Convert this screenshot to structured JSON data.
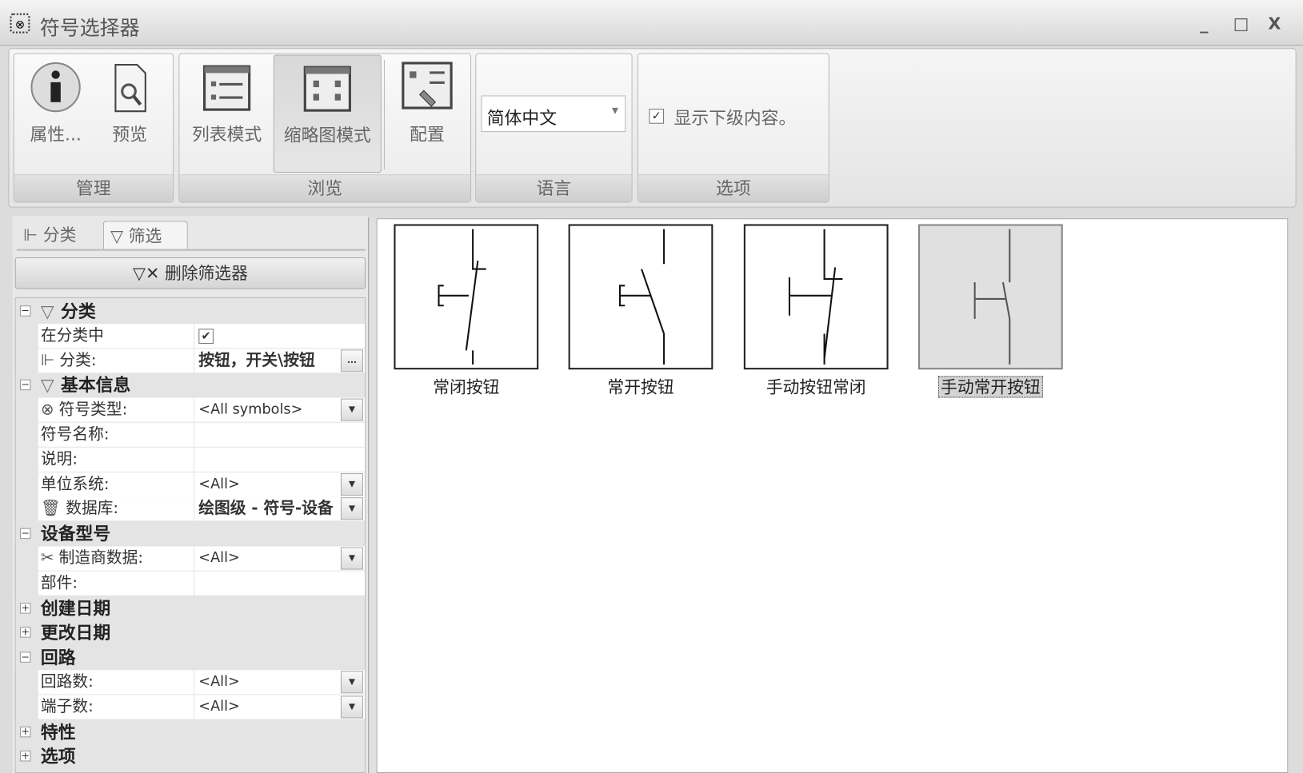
{
  "window": {
    "title": "符号选择器",
    "minimize": "_",
    "maximize": "□",
    "close": "X"
  },
  "ribbon": {
    "groups": {
      "manage": {
        "label": "管理",
        "properties": "属性...",
        "preview": "预览"
      },
      "browse": {
        "label": "浏览",
        "list_mode": "列表模式",
        "thumbnail_mode": "缩略图模式",
        "config": "配置"
      },
      "language": {
        "label": "语言",
        "value": "简体中文"
      },
      "options": {
        "label": "选项",
        "show_sub": "显示下级内容。",
        "show_sub_checked": true
      }
    }
  },
  "left": {
    "tabs": [
      {
        "label": "分类"
      },
      {
        "label": "筛选"
      }
    ],
    "delete_filter": "删除筛选器",
    "rows": [
      {
        "type": "group",
        "label": "分类",
        "expanded": true,
        "icon": "filter"
      },
      {
        "type": "check",
        "label": "在分类中",
        "checked": true
      },
      {
        "type": "more",
        "label": "分类:",
        "value": "按钮，开关\\按钮",
        "icon": "tree",
        "bold": true
      },
      {
        "type": "group",
        "label": "基本信息",
        "expanded": true,
        "icon": "filter"
      },
      {
        "type": "dropdown",
        "label": "符号类型:",
        "value": "<All symbols>",
        "icon": "symbol"
      },
      {
        "type": "text",
        "label": "符号名称:",
        "value": ""
      },
      {
        "type": "text",
        "label": "说明:",
        "value": ""
      },
      {
        "type": "dropdown",
        "label": "单位系统:",
        "value": "<All>"
      },
      {
        "type": "dropdown",
        "label": "数据库:",
        "value": "绘图级 - 符号-设备",
        "icon": "database",
        "bold": true
      },
      {
        "type": "group",
        "label": "设备型号",
        "expanded": true
      },
      {
        "type": "dropdown",
        "label": "制造商数据:",
        "value": "<All>",
        "icon": "tools"
      },
      {
        "type": "text",
        "label": "部件:",
        "value": ""
      },
      {
        "type": "group",
        "label": "创建日期",
        "expanded": false
      },
      {
        "type": "group",
        "label": "更改日期",
        "expanded": false
      },
      {
        "type": "group",
        "label": "回路",
        "expanded": true
      },
      {
        "type": "dropdown",
        "label": "回路数:",
        "value": "<All>"
      },
      {
        "type": "dropdown",
        "label": "端子数:",
        "value": "<All>"
      },
      {
        "type": "group",
        "label": "特性",
        "expanded": false
      },
      {
        "type": "group",
        "label": "选项",
        "expanded": false
      }
    ]
  },
  "symbols": [
    {
      "label": "常闭按钮"
    },
    {
      "label": "常开按钮"
    },
    {
      "label": "手动按钮常闭"
    },
    {
      "label": "手动常开按钮",
      "selected": true
    }
  ]
}
